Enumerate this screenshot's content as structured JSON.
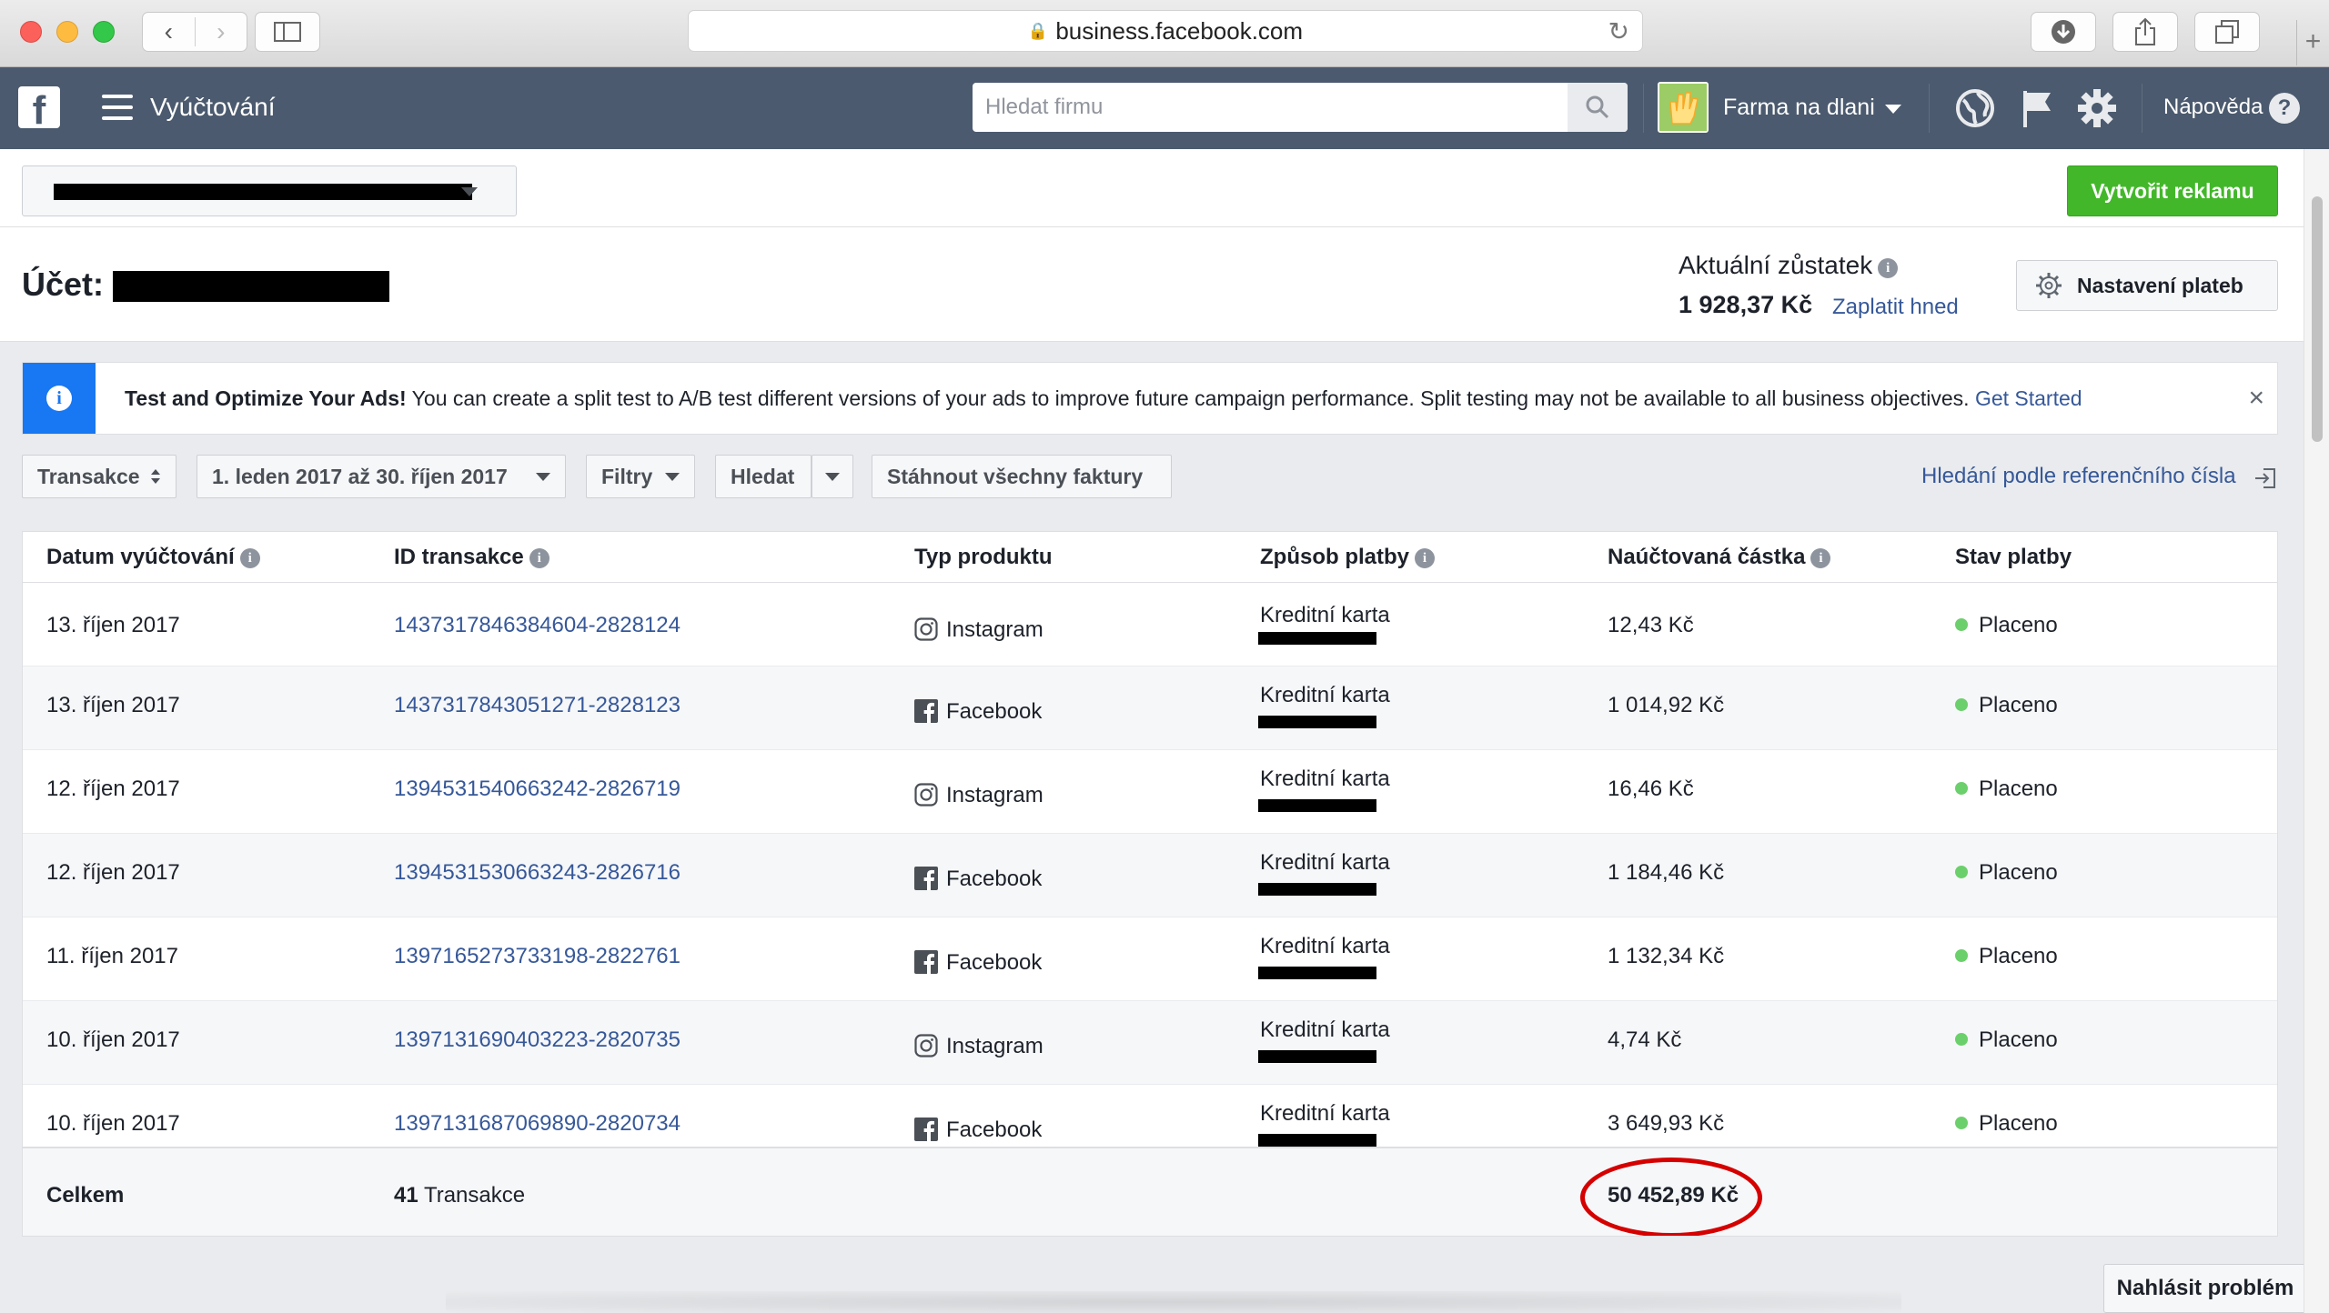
{
  "browser": {
    "url": "business.facebook.com"
  },
  "fb": {
    "section_title": "Vyúčtování",
    "search_placeholder": "Hledat firmu",
    "business_name": "Farma na dlani",
    "help_label": "Nápověda"
  },
  "toolbar": {
    "create_ad_label": "Vytvořit reklamu"
  },
  "account": {
    "label": "Účet:",
    "balance_label": "Aktuální zůstatek",
    "balance_amount": "1 928,37 Kč",
    "pay_now_label": "Zaplatit hned",
    "payment_settings_label": "Nastavení plateb"
  },
  "banner": {
    "title": "Test and Optimize Your Ads!",
    "text": "You can create a split test to A/B test different versions of your ads to improve future campaign performance. Split testing may not be available to all business objectives.",
    "link": "Get Started",
    "close": "×"
  },
  "filters": {
    "type_label": "Transakce",
    "date_range": "1. leden 2017 až 30. říjen 2017",
    "filters_label": "Filtry",
    "search_label": "Hledat",
    "download_label": "Stáhnout všechny faktury",
    "ref_search_label": "Hledání podle referenčního čísla"
  },
  "table": {
    "headers": {
      "date": "Datum vyúčtování",
      "id": "ID transakce",
      "product": "Typ produktu",
      "payment": "Způsob platby",
      "amount": "Naúčtovaná částka",
      "status": "Stav platby"
    },
    "rows": [
      {
        "date": "13. říjen 2017",
        "id": "1437317846384604-2828124",
        "product": "Instagram",
        "payment": "Kreditní karta",
        "amount": "12,43 Kč",
        "status": "Placeno"
      },
      {
        "date": "13. říjen 2017",
        "id": "1437317843051271-2828123",
        "product": "Facebook",
        "payment": "Kreditní karta",
        "amount": "1 014,92 Kč",
        "status": "Placeno"
      },
      {
        "date": "12. říjen 2017",
        "id": "1394531540663242-2826719",
        "product": "Instagram",
        "payment": "Kreditní karta",
        "amount": "16,46 Kč",
        "status": "Placeno"
      },
      {
        "date": "12. říjen 2017",
        "id": "1394531530663243-2826716",
        "product": "Facebook",
        "payment": "Kreditní karta",
        "amount": "1 184,46 Kč",
        "status": "Placeno"
      },
      {
        "date": "11. říjen 2017",
        "id": "1397165273733198-2822761",
        "product": "Facebook",
        "payment": "Kreditní karta",
        "amount": "1 132,34 Kč",
        "status": "Placeno"
      },
      {
        "date": "10. říjen 2017",
        "id": "1397131690403223-2820735",
        "product": "Instagram",
        "payment": "Kreditní karta",
        "amount": "4,74 Kč",
        "status": "Placeno"
      },
      {
        "date": "10. říjen 2017",
        "id": "1397131687069890-2820734",
        "product": "Facebook",
        "payment": "Kreditní karta",
        "amount": "3 649,93 Kč",
        "status": "Placeno"
      }
    ],
    "footer": {
      "label": "Celkem",
      "count": "41",
      "count_label": "Transakce",
      "total": "50 452,89 Kč"
    }
  },
  "report_problem_label": "Nahlásit problém",
  "colors": {
    "fb_bar": "#4b5a6e",
    "link": "#365899",
    "green_button": "#42b72a",
    "info_blue": "#1877f2",
    "status_paid": "#6bd06b",
    "highlight": "#d50000"
  }
}
